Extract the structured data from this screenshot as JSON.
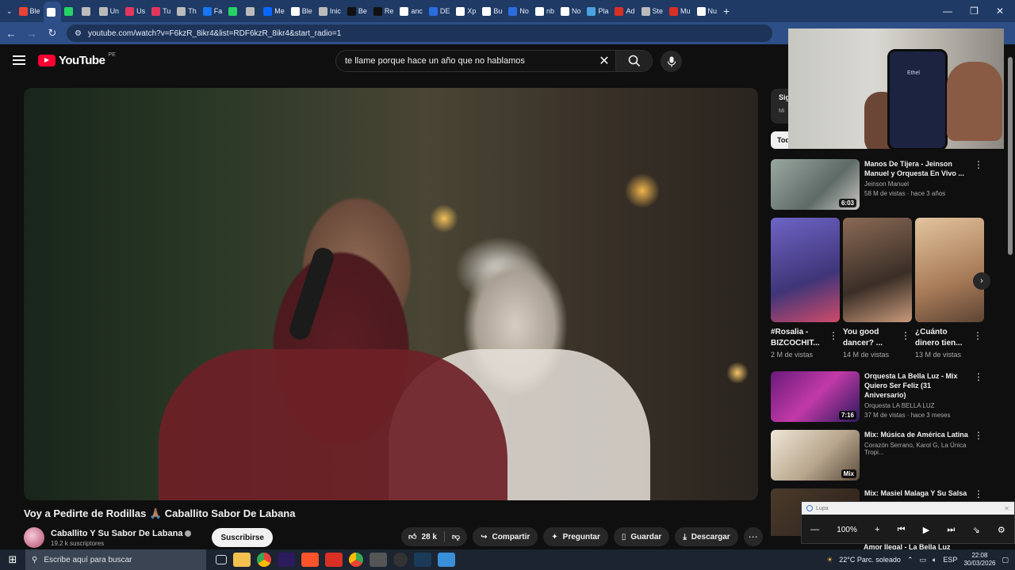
{
  "browser": {
    "tabs": [
      {
        "label": "Ble",
        "color": "#ea4335"
      },
      {
        "label": "",
        "color": "#ffffff",
        "active": true
      },
      {
        "label": "",
        "color": "#25d366"
      },
      {
        "label": "",
        "color": "#bbbbbb"
      },
      {
        "label": "Un",
        "color": "#bbbbbb"
      },
      {
        "label": "Us",
        "color": "#e3365e"
      },
      {
        "label": "Tu",
        "color": "#e3365e"
      },
      {
        "label": "Th",
        "color": "#bbbbbb"
      },
      {
        "label": "Fa",
        "color": "#1877f2"
      },
      {
        "label": "",
        "color": "#25d366"
      },
      {
        "label": "",
        "color": "#bbbbbb"
      },
      {
        "label": "Me",
        "color": "#0866ff"
      },
      {
        "label": "Ble",
        "color": "#ffffff"
      },
      {
        "label": "Inic",
        "color": "#bbbbbb"
      },
      {
        "label": "Be",
        "color": "#111111"
      },
      {
        "label": "Re",
        "color": "#111111"
      },
      {
        "label": "anc",
        "color": "#ffffff"
      },
      {
        "label": "DE",
        "color": "#2b6cde"
      },
      {
        "label": "Xp",
        "color": "#ffffff"
      },
      {
        "label": "Bu",
        "color": "#ffffff"
      },
      {
        "label": "No",
        "color": "#2b6cde"
      },
      {
        "label": "nb",
        "color": "#ffffff"
      },
      {
        "label": "No",
        "color": "#ffffff"
      },
      {
        "label": "Pla",
        "color": "#4aa3df"
      },
      {
        "label": "Ad",
        "color": "#d93025"
      },
      {
        "label": "Ste",
        "color": "#bbbbbb"
      },
      {
        "label": "Mu",
        "color": "#d93025"
      },
      {
        "label": "Nu",
        "color": "#ffffff"
      }
    ],
    "new_tab": "+",
    "window_controls": [
      "—",
      "❐",
      "✕"
    ],
    "url": "youtube.com/watch?v=F6kzR_8ikr4&list=RDF6kzR_8ikr4&start_radio=1"
  },
  "youtube": {
    "logo_text": "YouTube",
    "country_code": "PE",
    "search_query": "te llame porque hace un año que no hablamos",
    "colors": {
      "brand": "#ff0033",
      "bg": "#0f0f0f",
      "chip_bg": "#272727"
    }
  },
  "video": {
    "title": "Voy a Pedirte de Rodillas 🙏🏽 Caballito Sabor De Labana",
    "channel_name": "Caballito Y Su Sabor De Labana",
    "subscribers": "19.2 k suscriptores",
    "subscribe_label": "Suscribirse",
    "likes": "28 k",
    "share_label": "Compartir",
    "ask_label": "Preguntar",
    "save_label": "Guardar",
    "download_label": "Descargar"
  },
  "sidebar": {
    "partial_box": {
      "title": "Sig",
      "subtitle": "Mi"
    },
    "chip": "Tod",
    "recommendations": [
      {
        "title": "Manos De Tijera - Jeinson Manuel y Orquesta En Vivo ...",
        "channel": "Jeinson Manuel",
        "meta": "58 M de vistas · hace 3 años",
        "duration": "6:03",
        "color": "#7d8c86"
      },
      {
        "title": "Orquesta La Bella Luz - Mix Quiero Ser Feliz (31 Aniversario)",
        "channel": "Orquesta LA BELLA LUZ",
        "meta": "37 M de vistas · hace 3 meses",
        "duration": "7:16",
        "color": "#b02a8f"
      },
      {
        "title": "Mix: Música de América Latina",
        "channel": "Corazón Serrano, Karol G, La Única Tropi...",
        "meta": "",
        "duration": "Mix",
        "color": "#cfc6b8"
      },
      {
        "title": "Mix: Masiel Malaga Y Su Salsa",
        "channel": "",
        "meta": "",
        "duration": "",
        "color": "#3b2e22"
      }
    ],
    "shorts": [
      {
        "title": "#Rosalia - BIZCOCHIT...",
        "views": "2 M de vistas",
        "color": "#5a4fa0"
      },
      {
        "title": "You good dancer? ...",
        "views": "14 M de vistas",
        "color": "#6f4d3b"
      },
      {
        "title": "¿Cuánto dinero tien...",
        "views": "13 M de vistas",
        "color": "#b99070"
      }
    ],
    "partial_last": "Amor Ilegal - La Bella Luz"
  },
  "webcam": {
    "phone_name": "Ethel"
  },
  "magnifier": {
    "title": "Lupa",
    "zoom": "100%",
    "close": "✕"
  },
  "taskbar": {
    "search_placeholder": "Escribe aquí para buscar",
    "weather": "22°C  Parc. soleado",
    "lang": "ESP",
    "time": "22:08",
    "date": "30/03/2026"
  }
}
